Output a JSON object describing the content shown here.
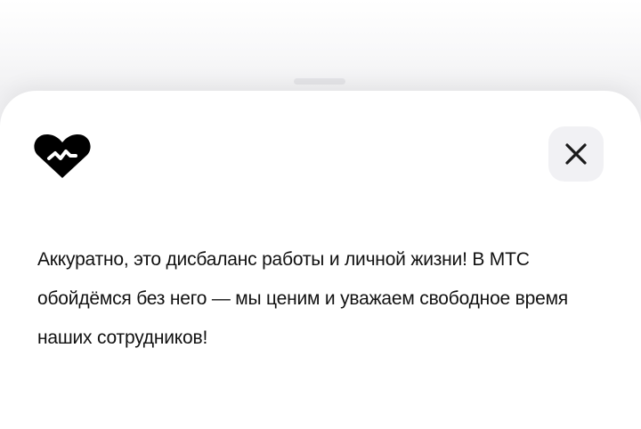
{
  "sheet": {
    "logo_icon": "heart-pulse-icon",
    "close_icon": "close-icon",
    "message": "Аккуратно, это дисбаланс работы и личной жизни! В МТС обойдёмся без него — мы ценим и уважаем свободное время наших сотрудников!"
  },
  "colors": {
    "text": "#111111",
    "sheet_background": "#ffffff",
    "close_button_background": "#f1f1f4",
    "logo": "#000000"
  }
}
